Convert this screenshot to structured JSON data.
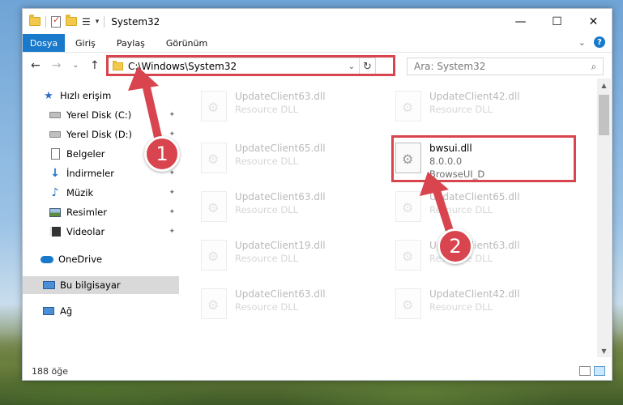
{
  "window": {
    "title": "System32"
  },
  "quick_access_toolbar": {
    "icons": [
      "folder-icon",
      "properties-icon",
      "new-folder-icon",
      "view-icon",
      "customize-arrow-icon"
    ]
  },
  "title_controls": {
    "minimize": "—",
    "maximize": "☐",
    "close": "✕"
  },
  "ribbon": {
    "file_tab": "Dosya",
    "tabs": [
      "Giriş",
      "Paylaş",
      "Görünüm"
    ],
    "expand_glyph": "⌄",
    "help_glyph": "?"
  },
  "address": {
    "path": "C:\\Windows\\System32",
    "dropdown_glyph": "⌄",
    "refresh_glyph": "↻",
    "search_placeholder": "Ara: System32",
    "search_glyph": "⌕"
  },
  "nav_buttons": {
    "back": "←",
    "forward": "→",
    "recent": "⌄",
    "up": "↑"
  },
  "sidebar": {
    "items": [
      {
        "label": "Hızlı erişim",
        "icon": "star-icon",
        "pinned": false
      },
      {
        "label": "Yerel Disk (C:)",
        "icon": "disk-icon",
        "pinned": true
      },
      {
        "label": "Yerel Disk (D:)",
        "icon": "disk-icon",
        "pinned": true
      },
      {
        "label": "Belgeler",
        "icon": "document-icon",
        "pinned": true
      },
      {
        "label": "İndirmeler",
        "icon": "download-icon",
        "pinned": true
      },
      {
        "label": "Müzik",
        "icon": "music-icon",
        "pinned": true
      },
      {
        "label": "Resimler",
        "icon": "pictures-icon",
        "pinned": true
      },
      {
        "label": "Videolar",
        "icon": "videos-icon",
        "pinned": true
      },
      {
        "label": "OneDrive",
        "icon": "cloud-icon",
        "pinned": false
      },
      {
        "label": "Bu bilgisayar",
        "icon": "computer-icon",
        "pinned": false,
        "selected": true
      },
      {
        "label": "Ağ",
        "icon": "network-icon",
        "pinned": false
      }
    ],
    "pin_glyph": "📌"
  },
  "files": [
    {
      "name": "UpdateClient63.dll",
      "sub": "Resource DLL",
      "faded": true
    },
    {
      "name": "UpdateClient42.dll",
      "sub": "Resource DLL",
      "faded": true
    },
    {
      "name": "UpdateClient65.dll",
      "sub": "Resource DLL",
      "faded": true
    },
    {
      "name": "bwsui.dll",
      "sub": "8.0.0.0",
      "sub2": "BrowseUI_D",
      "faded": false
    },
    {
      "name": "UpdateClient63.dll",
      "sub": "Resource DLL",
      "faded": true
    },
    {
      "name": "UpdateClient65.dll",
      "sub": "Resource DLL",
      "faded": true
    },
    {
      "name": "UpdateClient19.dll",
      "sub": "Resource DLL",
      "faded": true
    },
    {
      "name": "UpdateClient63.dll",
      "sub": "Resource DLL",
      "faded": true
    },
    {
      "name": "UpdateClient63.dll",
      "sub": "Resource DLL",
      "faded": true
    },
    {
      "name": "UpdateClient42.dll",
      "sub": "Resource DLL",
      "faded": true
    }
  ],
  "status": {
    "count_text": "188 öğe"
  },
  "callouts": [
    "1",
    "2"
  ],
  "colors": {
    "accent": "#1979ca",
    "highlight_red": "#d9454e",
    "selected_nav": "#d9d9d9"
  }
}
